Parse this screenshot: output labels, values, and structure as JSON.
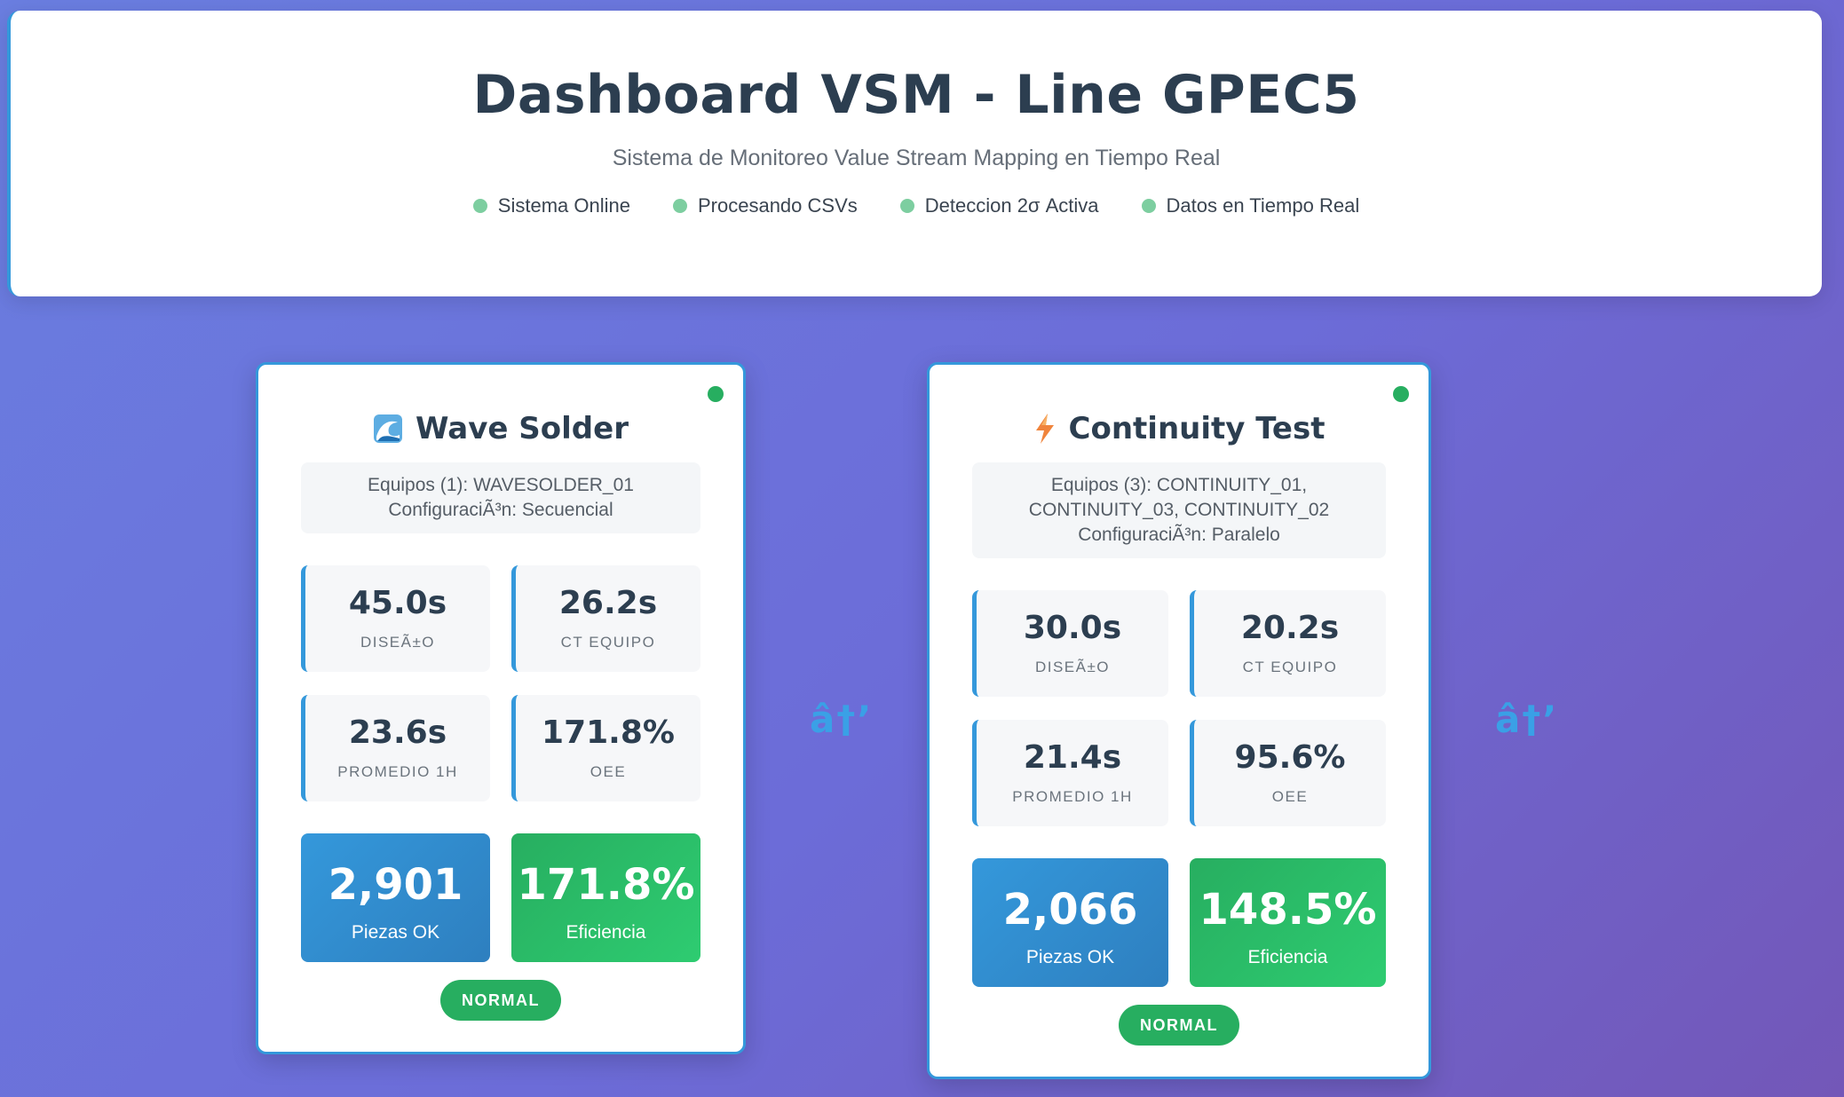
{
  "header": {
    "title": "Dashboard VSM - Line GPEC5",
    "subtitle": "Sistema de Monitoreo Value Stream Mapping en Tiempo Real",
    "status": [
      {
        "label": "Sistema Online"
      },
      {
        "label": "Procesando CSVs"
      },
      {
        "label": "Deteccion 2σ Activa"
      },
      {
        "label": "Datos en Tiempo Real"
      }
    ]
  },
  "stations": [
    {
      "icon": "wave-icon",
      "name": "Wave Solder",
      "equipos": "Equipos (1): WAVESOLDER_01",
      "configuracion": "ConfiguraciÃ³n: Secuencial",
      "metrics": {
        "design": {
          "value": "45.0s",
          "label": "DISEÃ±O"
        },
        "ct_equipo": {
          "value": "26.2s",
          "label": "CT EQUIPO"
        },
        "promedio": {
          "value": "23.6s",
          "label": "PROMEDIO 1H"
        },
        "oee": {
          "value": "171.8%",
          "label": "OEE"
        }
      },
      "piezas": {
        "value": "2,901",
        "label": "Piezas OK"
      },
      "eficiencia": {
        "value": "171.8%",
        "label": "Eficiencia"
      },
      "status": "NORMAL"
    },
    {
      "icon": "lightning-icon",
      "name": "Continuity Test",
      "equipos": "Equipos (3): CONTINUITY_01, CONTINUITY_03, CONTINUITY_02",
      "configuracion": "ConfiguraciÃ³n: Paralelo",
      "metrics": {
        "design": {
          "value": "30.0s",
          "label": "DISEÃ±O"
        },
        "ct_equipo": {
          "value": "20.2s",
          "label": "CT EQUIPO"
        },
        "promedio": {
          "value": "21.4s",
          "label": "PROMEDIO 1H"
        },
        "oee": {
          "value": "95.6%",
          "label": "OEE"
        }
      },
      "piezas": {
        "value": "2,066",
        "label": "Piezas OK"
      },
      "eficiencia": {
        "value": "148.5%",
        "label": "Eficiencia"
      },
      "status": "NORMAL"
    }
  ],
  "flow_arrows": [
    "â†’",
    "â†’"
  ],
  "colors": {
    "accent": "#3498db",
    "success": "#27ae60",
    "text": "#2c3e50"
  }
}
